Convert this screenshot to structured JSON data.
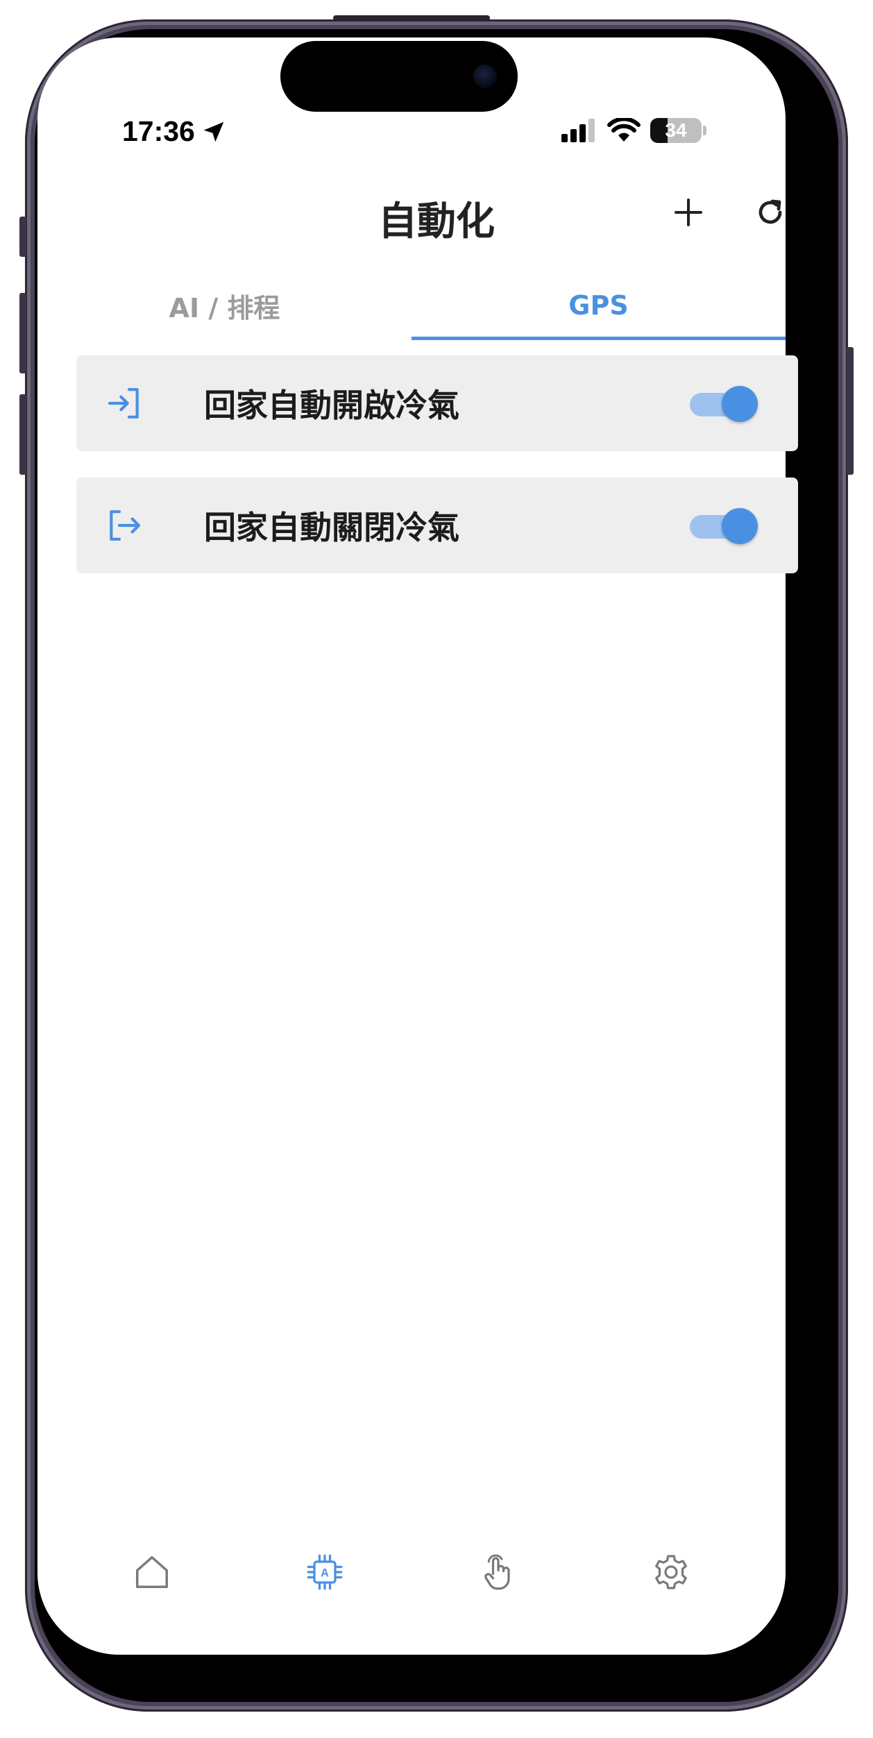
{
  "status_bar": {
    "time": "17:36",
    "battery": "34",
    "battery_level_percent": 34
  },
  "header": {
    "title": "自動化",
    "add_icon": "plus-icon",
    "refresh_icon": "refresh-icon"
  },
  "tabs": [
    {
      "label": "AI / 排程",
      "active": false
    },
    {
      "label": "GPS",
      "active": true
    }
  ],
  "automations": [
    {
      "label": "回家自動開啟冷氣",
      "icon": "enter-icon",
      "enabled": true
    },
    {
      "label": "回家自動關閉冷氣",
      "icon": "exit-icon",
      "enabled": true
    }
  ],
  "bottom_nav": [
    {
      "name": "home",
      "icon": "home-icon",
      "active": false
    },
    {
      "name": "automation",
      "icon": "ai-chip-icon",
      "active": true
    },
    {
      "name": "control",
      "icon": "hand-pointer-icon",
      "active": false
    },
    {
      "name": "settings",
      "icon": "gear-icon",
      "active": false
    }
  ],
  "colors": {
    "accent": "#4a90e2",
    "inactive_tab": "#9b9b9b",
    "row_background": "#eeeeee",
    "toggle_track": "#9ec1ee",
    "icon_gray": "#7a7a7a"
  }
}
